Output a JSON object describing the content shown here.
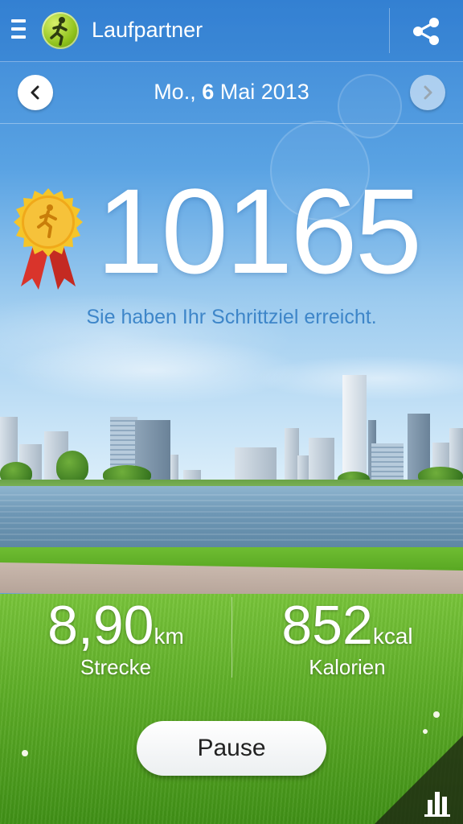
{
  "app": {
    "title": "Laufpartner"
  },
  "date": {
    "prefix": "Mo., ",
    "day": "6",
    "suffix": " Mai 2013"
  },
  "steps": {
    "count": "10165",
    "goal_message": "Sie haben Ihr Schrittziel erreicht."
  },
  "stats": {
    "distance": {
      "value": "8,90",
      "unit": "km",
      "label": "Strecke"
    },
    "calories": {
      "value": "852",
      "unit": "kcal",
      "label": "Kalorien"
    }
  },
  "controls": {
    "pause_label": "Pause"
  },
  "icons": {
    "menu": "menu-icon",
    "app": "runner-app-icon",
    "share": "share-icon",
    "prev": "chevron-left-icon",
    "next": "chevron-right-icon",
    "medal": "goal-medal-icon",
    "stats": "bar-chart-icon"
  },
  "colors": {
    "goal_message": "#3e86c9",
    "medal_gold": "#f2b51c",
    "ribbon": "#d9342b"
  }
}
